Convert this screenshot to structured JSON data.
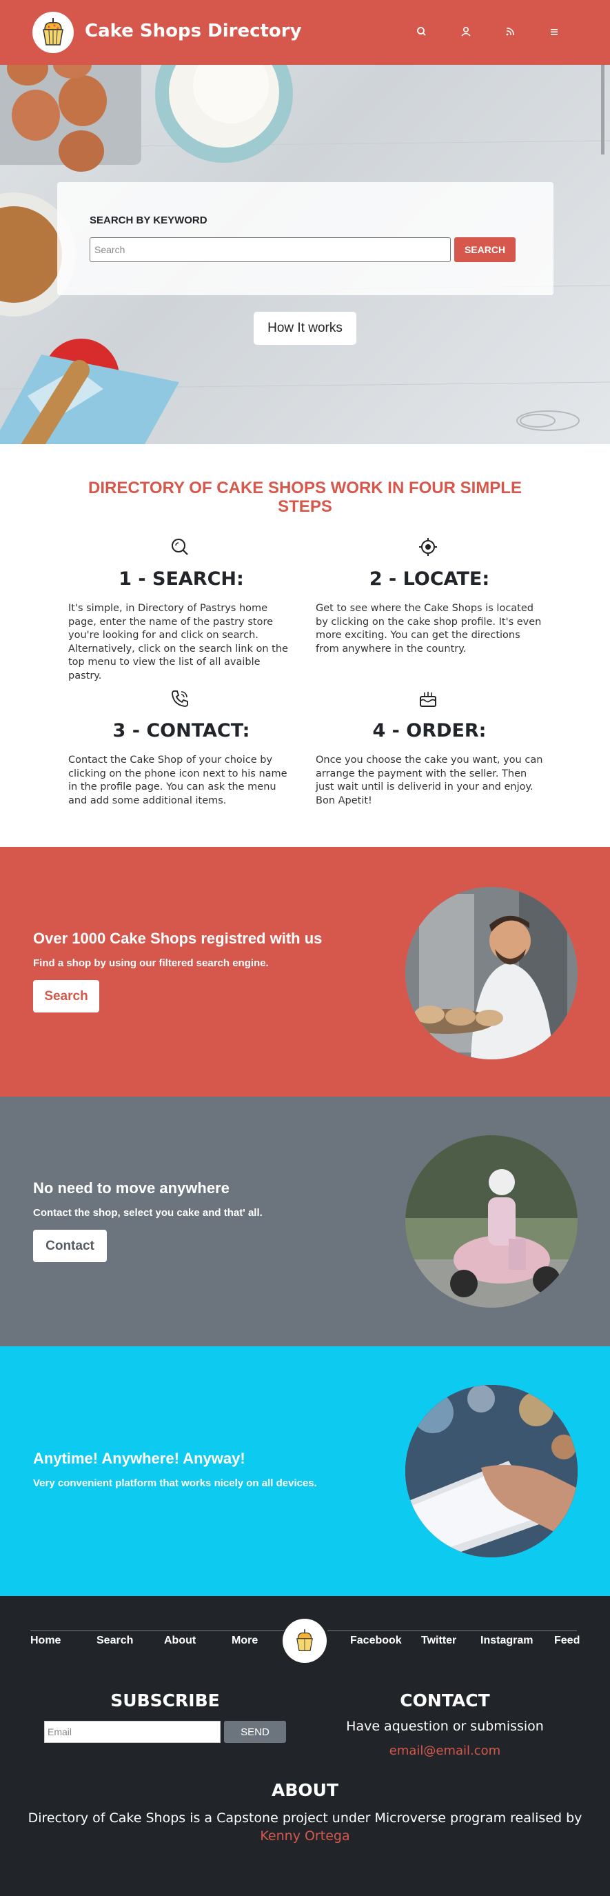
{
  "brand": {
    "title": "Cake Shops Directory"
  },
  "nav_icons": [
    "search-icon",
    "user-icon",
    "rss-icon",
    "menu-icon"
  ],
  "hero": {
    "search_label": "SEARCH BY KEYWORD",
    "search_placeholder": "Search",
    "search_button": "SEARCH",
    "how_button": "How It works"
  },
  "steps": {
    "title": "DIRECTORY OF CAKE SHOPS WORK IN FOUR SIMPLE STEPS",
    "items": [
      {
        "icon": "search-zoom-icon",
        "heading": "1 - SEARCH:",
        "text": "It's simple, in Directory of Pastrys home page, enter the name of the pastry store you're looking for and click on search. Alternatively, click on the search link on the top menu to view the list of all avaible pastry."
      },
      {
        "icon": "crosshair-icon",
        "heading": "2 - LOCATE:",
        "text": "Get to see where the Cake Shops is located by clicking on the cake shop profile. It's even more exciting. You can get the directions from anywhere in the country."
      },
      {
        "icon": "phone-icon",
        "heading": "3 - CONTACT:",
        "text": "Contact the Cake Shop of your choice by clicking on the phone icon next to his name in the profile page. You can ask the menu and add some additional items."
      },
      {
        "icon": "cake-icon",
        "heading": "4 - ORDER:",
        "text": "Once you choose the cake you want, you can arrange the payment with the seller. Then just wait until is deliverid in your and enjoy. Bon Apetit!"
      }
    ]
  },
  "bands": [
    {
      "title": "Over 1000 Cake Shops registred with us",
      "subtitle": "Find a shop by using our filtered search engine.",
      "button": "Search",
      "color": "#d6584c"
    },
    {
      "title": "No need to move anywhere",
      "subtitle": "Contact the shop, select you cake and that' all.",
      "button": "Contact",
      "color": "#6c757d"
    },
    {
      "title": "Anytime! Anywhere! Anyway!",
      "subtitle": "Very convenient platform that works nicely on all devices.",
      "button": "",
      "color": "#0dcaf0"
    }
  ],
  "footer": {
    "links_left": [
      "Home",
      "Search",
      "About",
      "More"
    ],
    "links_right": [
      "Facebook",
      "Twitter",
      "Instagram",
      "Feed"
    ],
    "subscribe_title": "SUBSCRIBE",
    "email_placeholder": "Email",
    "send_button": "SEND",
    "contact_title": "CONTACT",
    "contact_text": "Have aquestion or submission",
    "contact_email": "email@email.com",
    "about_title": "ABOUT",
    "about_text": "Directory of Cake Shops is a Capstone project under Microverse program realised by",
    "about_author": "Kenny Ortega"
  },
  "colors": {
    "accent": "#d6584c",
    "dark": "#212529",
    "gray": "#6c757d",
    "cyan": "#0dcaf0"
  }
}
